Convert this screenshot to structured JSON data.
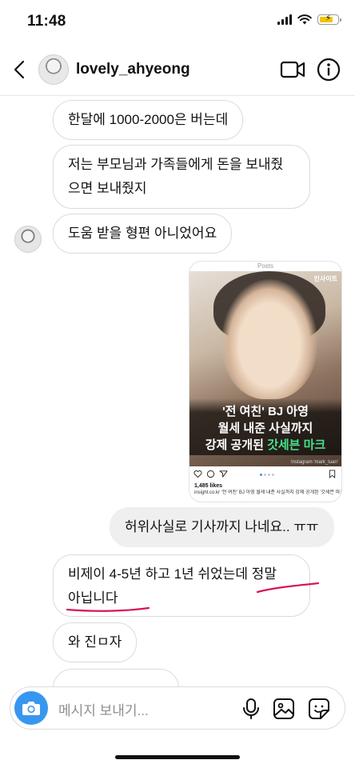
{
  "status_bar": {
    "time": "11:48",
    "battery_color": "#f5c400",
    "battery_charging": true,
    "icons": [
      "signal-icon",
      "wifi-icon",
      "battery-icon"
    ]
  },
  "header": {
    "username": "lovely_ahyeong",
    "icons": [
      "back-chevron-icon",
      "video-call-icon",
      "info-icon"
    ]
  },
  "messages": [
    {
      "side": "left",
      "text": "한달에 1000-2000은 버는데"
    },
    {
      "side": "left",
      "lines": [
        "저는 부모님과 가족들에게 돈을 보내줬",
        "으면 보내줬지"
      ]
    },
    {
      "side": "left",
      "text": "도움 받을 형편 아니었어요",
      "show_avatar": true
    },
    {
      "side": "right",
      "type": "shared_post"
    },
    {
      "side": "right",
      "text": "허위사실로 기사까지 나네요.. ㅠㅠ"
    },
    {
      "side": "left",
      "lines": [
        "비제이 4-5년 하고 1년 쉬었는데 정말",
        "아닙니다"
      ],
      "annotation": "red underline"
    },
    {
      "side": "left",
      "text": "와 진ㅁ자"
    }
  ],
  "shared_post": {
    "header_label": "Posts",
    "brand": "인사이트",
    "headline_lines": [
      "'전 여친' BJ 아영",
      "월세 내준 사실까지",
      "강제 공개된"
    ],
    "headline_accent": "갓세븐 마크",
    "photo_credit": "Instagram 'mark_tuan'",
    "likes": "1,485 likes",
    "caption": "insight.co.kr '전 여친' BJ 아영 월세 내준 사실까지 강제 공개된 '갓세븐 마크",
    "accent_color": "#47e08a"
  },
  "composer": {
    "placeholder": "메시지 보내기...",
    "camera_color": "#3797f0",
    "icons": [
      "camera-icon",
      "microphone-icon",
      "gallery-icon",
      "sticker-icon"
    ]
  },
  "annotation_color": "#d9145e"
}
